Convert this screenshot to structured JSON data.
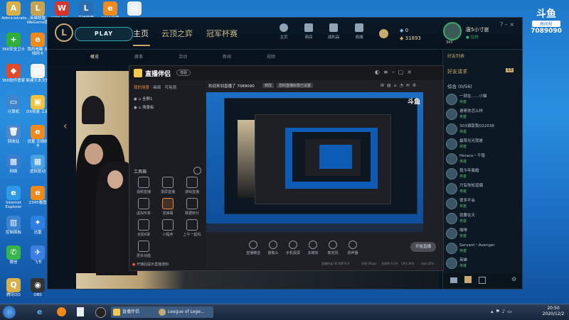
{
  "desktop_icons": [
    {
      "label": "Administrato...",
      "glyph": "A",
      "color": "#d8b04a"
    },
    {
      "label": "英雄联盟 WeGame版",
      "glyph": "L",
      "color": "#c9a24e"
    },
    {
      "label": "WPS Office",
      "glyph": "W",
      "color": "#d9342b"
    },
    {
      "label": "英雄联盟",
      "glyph": "L",
      "color": "#2a6db0"
    },
    {
      "label": "2019宁夏",
      "glyph": "e",
      "color": "#f08a1c"
    },
    {
      "label": "",
      "glyph": "▤",
      "color": "#e9eef5"
    },
    {
      "label": "360安全卫士",
      "glyph": "+",
      "color": "#2fae3d"
    },
    {
      "label": "我的电脑 无线网卡",
      "glyph": "e",
      "color": "#f08a1c"
    },
    {
      "label": "360软件管家",
      "glyph": "◆",
      "color": "#e24a2c"
    },
    {
      "label": "新建文本文档",
      "glyph": "▤",
      "color": "#f2f2f2"
    },
    {
      "label": "计算机",
      "glyph": "▭",
      "color": "#3d86cf"
    },
    {
      "label": "DX修复 工具",
      "glyph": "▣",
      "color": "#f3c23a"
    },
    {
      "label": "回收站",
      "glyph": "🗑",
      "color": "#4f87c9"
    },
    {
      "label": "设置 无线网卡",
      "glyph": "e",
      "color": "#f08a1c"
    },
    {
      "label": "网络",
      "glyph": "▩",
      "color": "#3a7dd0"
    },
    {
      "label": "虚拟驱动",
      "glyph": "▦",
      "color": "#4aa0e0"
    },
    {
      "label": "Internet Explorer",
      "glyph": "e",
      "color": "#2d9ae8"
    },
    {
      "label": "2345看图",
      "glyph": "e",
      "color": "#f08a1c"
    },
    {
      "label": "控制面板",
      "glyph": "▥",
      "color": "#3a83cf"
    },
    {
      "label": "迅雷",
      "glyph": "✦",
      "color": "#2d7fe0"
    },
    {
      "label": "微信",
      "glyph": "✆",
      "color": "#38b54a"
    },
    {
      "label": "飞书",
      "glyph": "✈",
      "color": "#3d7fe0"
    },
    {
      "label": "OBS",
      "glyph": "◉",
      "color": "#333333"
    },
    {
      "label": "腾讯QQ",
      "glyph": "Q",
      "color": "#d8b04a"
    }
  ],
  "lol": {
    "play_label": "PLAY",
    "tabs": [
      "主页",
      "云顶之弈",
      "冠军杯赛"
    ],
    "nav_icons": [
      "主页",
      "商店",
      "战利品",
      "商城"
    ],
    "be": "0",
    "rp": "31893",
    "summoner": "唐5小寸崽",
    "level": "343",
    "status": "在线",
    "subtabs": [
      "概览",
      "赛事",
      "活动",
      "新闻",
      "视频"
    ],
    "friends_header": "好友列表",
    "friends_request": "好友请求",
    "friends_count": "13",
    "friends_group": "综合 (0/56)",
    "friends": [
      {
        "name": "一刻在……小猫",
        "status": "英雄"
      },
      {
        "name": "谢哥你怎么样",
        "status": "英雄"
      },
      {
        "name": "303湖南我Q22038",
        "status": "英雄"
      },
      {
        "name": "最菜光光我是",
        "status": "英雄"
      },
      {
        "name": "Horace丶干隐",
        "status": "英雄"
      },
      {
        "name": "我今年离婚",
        "status": "英雄"
      },
      {
        "name": "只有你知道偶",
        "status": "英雄"
      },
      {
        "name": "很多不会",
        "status": "英雄"
      },
      {
        "name": "就要在天",
        "status": "英雄"
      },
      {
        "name": "咖啡",
        "status": "英雄"
      },
      {
        "name": "Servant丶Avenger",
        "status": "英雄"
      },
      {
        "name": "英雄",
        "status": "英雄"
      }
    ]
  },
  "douyu": {
    "logo_text": "斗鱼",
    "subtitle": "房间号",
    "room_id": "7089090"
  },
  "stream_app": {
    "title": "直播伴侣",
    "badge": "体验",
    "welcome": "欢迎来到直播了 7089090",
    "tag1": "修改",
    "tag2": "您的直播标签已设置",
    "left_tabs": [
      "我的场景",
      "画面",
      "可用源"
    ],
    "scenes": [
      "全屏1",
      "场景标"
    ],
    "toolbox_label": "工具箱",
    "tools": [
      "视频直播",
      "录屏直播",
      "游戏直播",
      "虚拟形象",
      "发弹幕",
      "数据统计",
      "全民K歌",
      "小程序",
      "上午一起吗",
      "更多功能"
    ],
    "bottom_tools": [
      "直播精选",
      "摄像头",
      "手机投屏",
      "多媒体",
      "麦克风",
      "扬声器"
    ],
    "start_button": "开始直播",
    "status_text": "开播后提示直播通知",
    "meters": [
      "直播时长:00:00",
      "FPS:0",
      "码率:0kbps",
      "丢帧率:0.0%",
      "CPU:30%",
      "内存:42%"
    ]
  },
  "taskbar": {
    "items": [
      "直播伴侣",
      "League of Lege..."
    ],
    "clock_time": "20:50",
    "clock_date": "2020/12/2"
  }
}
